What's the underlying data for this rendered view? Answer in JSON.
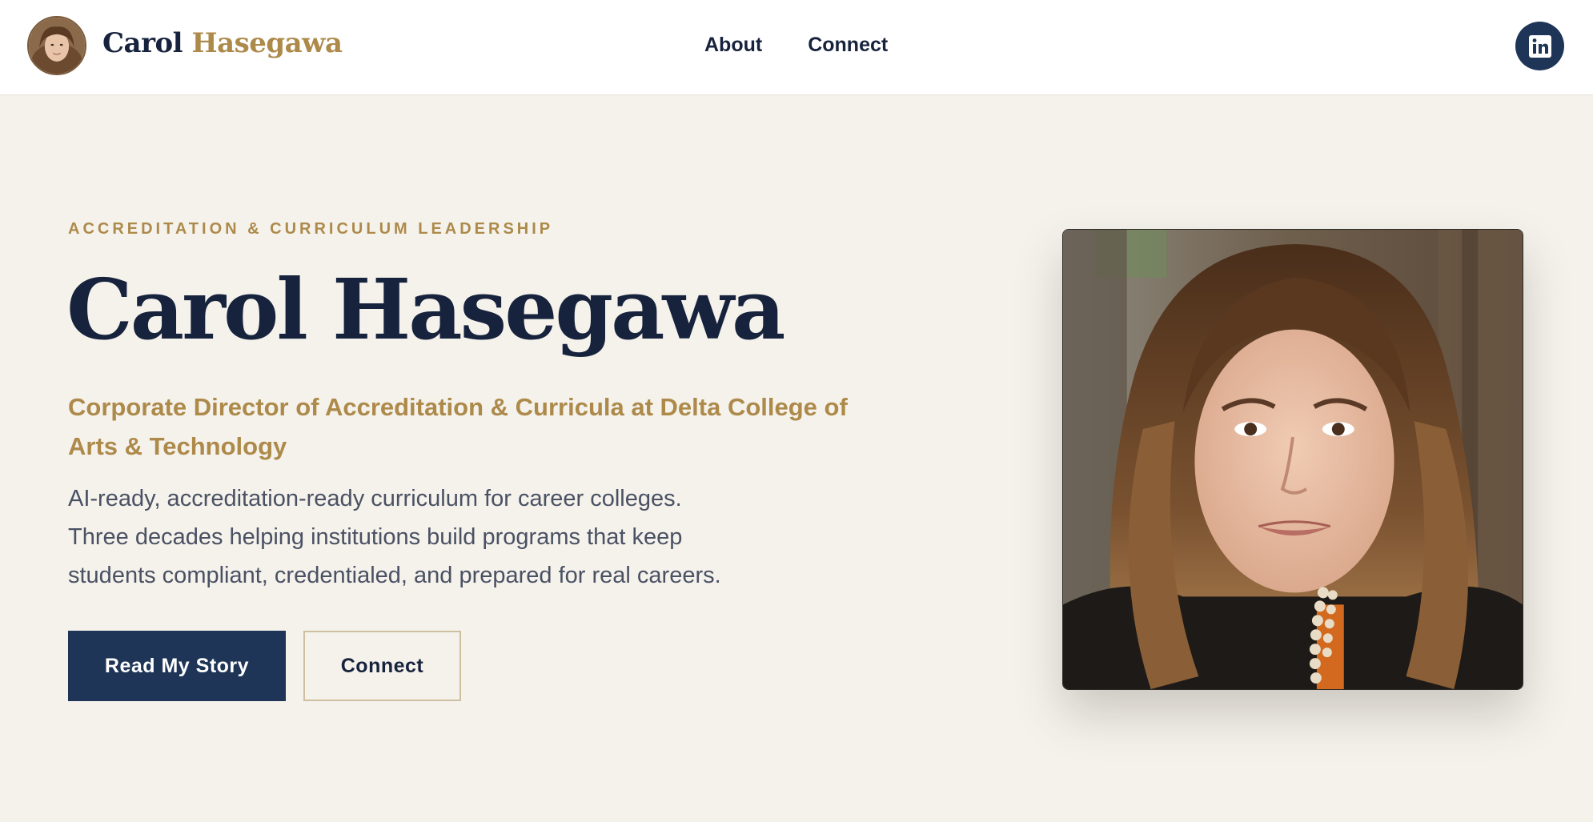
{
  "header": {
    "brand_first": "Carol",
    "brand_last": "Hasegawa",
    "nav": [
      "About",
      "Connect"
    ],
    "social_icon": "linkedin-icon",
    "avatar_alt": "Carol Hasegawa avatar"
  },
  "hero": {
    "eyebrow": "ACCREDITATION & CURRICULUM LEADERSHIP",
    "name": "Carol Hasegawa",
    "role": "Corporate Director of Accreditation & Curricula at Delta College of Arts & Technology",
    "intro_lines": [
      "AI-ready, accreditation-ready curriculum for career colleges.",
      "Three decades helping institutions build programs that keep",
      "students compliant, credentialed, and prepared for real careers."
    ],
    "primary_button": "Read My Story",
    "secondary_button": "Connect",
    "portrait_alt": "Portrait of Carol Hasegawa"
  },
  "colors": {
    "navy": "#17233d",
    "button_navy": "#1f3558",
    "gold": "#ad8a4a",
    "background": "#f5f2ec",
    "body_text": "#4a5163"
  }
}
